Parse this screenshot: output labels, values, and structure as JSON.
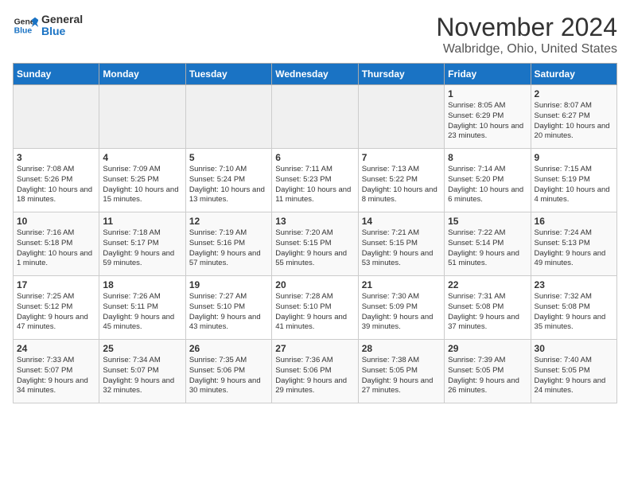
{
  "header": {
    "logo_line1": "General",
    "logo_line2": "Blue",
    "title": "November 2024",
    "location": "Walbridge, Ohio, United States"
  },
  "days_of_week": [
    "Sunday",
    "Monday",
    "Tuesday",
    "Wednesday",
    "Thursday",
    "Friday",
    "Saturday"
  ],
  "weeks": [
    [
      {
        "day": "",
        "content": ""
      },
      {
        "day": "",
        "content": ""
      },
      {
        "day": "",
        "content": ""
      },
      {
        "day": "",
        "content": ""
      },
      {
        "day": "",
        "content": ""
      },
      {
        "day": "1",
        "content": "Sunrise: 8:05 AM\nSunset: 6:29 PM\nDaylight: 10 hours and 23 minutes."
      },
      {
        "day": "2",
        "content": "Sunrise: 8:07 AM\nSunset: 6:27 PM\nDaylight: 10 hours and 20 minutes."
      }
    ],
    [
      {
        "day": "3",
        "content": "Sunrise: 7:08 AM\nSunset: 5:26 PM\nDaylight: 10 hours and 18 minutes."
      },
      {
        "day": "4",
        "content": "Sunrise: 7:09 AM\nSunset: 5:25 PM\nDaylight: 10 hours and 15 minutes."
      },
      {
        "day": "5",
        "content": "Sunrise: 7:10 AM\nSunset: 5:24 PM\nDaylight: 10 hours and 13 minutes."
      },
      {
        "day": "6",
        "content": "Sunrise: 7:11 AM\nSunset: 5:23 PM\nDaylight: 10 hours and 11 minutes."
      },
      {
        "day": "7",
        "content": "Sunrise: 7:13 AM\nSunset: 5:22 PM\nDaylight: 10 hours and 8 minutes."
      },
      {
        "day": "8",
        "content": "Sunrise: 7:14 AM\nSunset: 5:20 PM\nDaylight: 10 hours and 6 minutes."
      },
      {
        "day": "9",
        "content": "Sunrise: 7:15 AM\nSunset: 5:19 PM\nDaylight: 10 hours and 4 minutes."
      }
    ],
    [
      {
        "day": "10",
        "content": "Sunrise: 7:16 AM\nSunset: 5:18 PM\nDaylight: 10 hours and 1 minute."
      },
      {
        "day": "11",
        "content": "Sunrise: 7:18 AM\nSunset: 5:17 PM\nDaylight: 9 hours and 59 minutes."
      },
      {
        "day": "12",
        "content": "Sunrise: 7:19 AM\nSunset: 5:16 PM\nDaylight: 9 hours and 57 minutes."
      },
      {
        "day": "13",
        "content": "Sunrise: 7:20 AM\nSunset: 5:15 PM\nDaylight: 9 hours and 55 minutes."
      },
      {
        "day": "14",
        "content": "Sunrise: 7:21 AM\nSunset: 5:15 PM\nDaylight: 9 hours and 53 minutes."
      },
      {
        "day": "15",
        "content": "Sunrise: 7:22 AM\nSunset: 5:14 PM\nDaylight: 9 hours and 51 minutes."
      },
      {
        "day": "16",
        "content": "Sunrise: 7:24 AM\nSunset: 5:13 PM\nDaylight: 9 hours and 49 minutes."
      }
    ],
    [
      {
        "day": "17",
        "content": "Sunrise: 7:25 AM\nSunset: 5:12 PM\nDaylight: 9 hours and 47 minutes."
      },
      {
        "day": "18",
        "content": "Sunrise: 7:26 AM\nSunset: 5:11 PM\nDaylight: 9 hours and 45 minutes."
      },
      {
        "day": "19",
        "content": "Sunrise: 7:27 AM\nSunset: 5:10 PM\nDaylight: 9 hours and 43 minutes."
      },
      {
        "day": "20",
        "content": "Sunrise: 7:28 AM\nSunset: 5:10 PM\nDaylight: 9 hours and 41 minutes."
      },
      {
        "day": "21",
        "content": "Sunrise: 7:30 AM\nSunset: 5:09 PM\nDaylight: 9 hours and 39 minutes."
      },
      {
        "day": "22",
        "content": "Sunrise: 7:31 AM\nSunset: 5:08 PM\nDaylight: 9 hours and 37 minutes."
      },
      {
        "day": "23",
        "content": "Sunrise: 7:32 AM\nSunset: 5:08 PM\nDaylight: 9 hours and 35 minutes."
      }
    ],
    [
      {
        "day": "24",
        "content": "Sunrise: 7:33 AM\nSunset: 5:07 PM\nDaylight: 9 hours and 34 minutes."
      },
      {
        "day": "25",
        "content": "Sunrise: 7:34 AM\nSunset: 5:07 PM\nDaylight: 9 hours and 32 minutes."
      },
      {
        "day": "26",
        "content": "Sunrise: 7:35 AM\nSunset: 5:06 PM\nDaylight: 9 hours and 30 minutes."
      },
      {
        "day": "27",
        "content": "Sunrise: 7:36 AM\nSunset: 5:06 PM\nDaylight: 9 hours and 29 minutes."
      },
      {
        "day": "28",
        "content": "Sunrise: 7:38 AM\nSunset: 5:05 PM\nDaylight: 9 hours and 27 minutes."
      },
      {
        "day": "29",
        "content": "Sunrise: 7:39 AM\nSunset: 5:05 PM\nDaylight: 9 hours and 26 minutes."
      },
      {
        "day": "30",
        "content": "Sunrise: 7:40 AM\nSunset: 5:05 PM\nDaylight: 9 hours and 24 minutes."
      }
    ]
  ]
}
